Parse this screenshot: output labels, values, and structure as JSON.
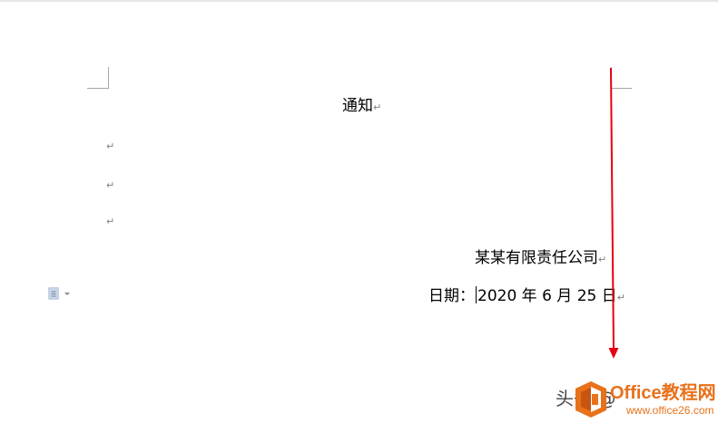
{
  "document": {
    "title": "通知",
    "company": "某某有限责任公司",
    "date_label": "日期：",
    "date_value": "2020 年 6 月 25 日",
    "paragraph_mark": "↵"
  },
  "watermark": {
    "prefix": "头条 @",
    "brand": "Office教程网",
    "url": "www.office26.com"
  },
  "colors": {
    "arrow": "#e60012",
    "brand": "#e8711b"
  },
  "icons": {
    "paste_options": "paste-options-icon",
    "logo": "office-logo-icon"
  }
}
